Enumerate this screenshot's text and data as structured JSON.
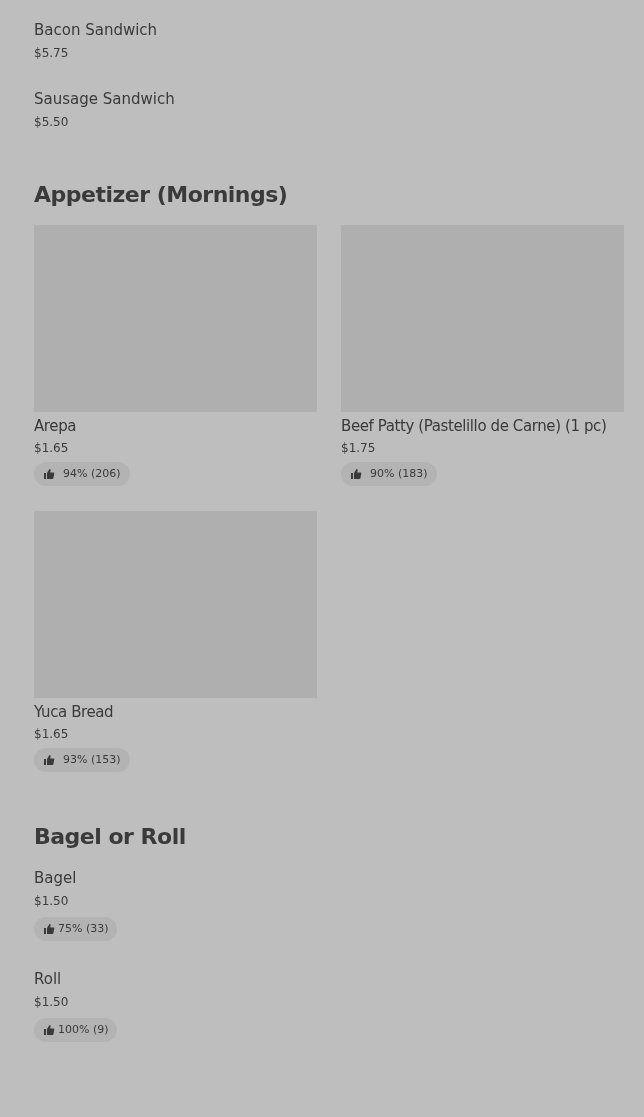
{
  "sections": [
    {
      "kind": "list",
      "items": [
        {
          "name": "Bacon Sandwich",
          "price": "$5.75"
        },
        {
          "name": "Sausage Sandwich",
          "price": "$5.50"
        }
      ]
    },
    {
      "heading": "Appetizer (Mornings)",
      "kind": "grid",
      "items": [
        {
          "name": "Arepa",
          "price": "$1.65",
          "rating": "94% (206)"
        },
        {
          "name": "Beef Patty (Pastelillo de Carne) (1 pc)",
          "price": "$1.75",
          "rating": "90% (183)"
        },
        {
          "name": "Yuca Bread",
          "price": "$1.65",
          "rating": "93% (153)"
        }
      ]
    },
    {
      "heading": "Bagel or Roll",
      "kind": "list",
      "items": [
        {
          "name": "Bagel",
          "price": "$1.50",
          "rating": "75% (33)"
        },
        {
          "name": "Roll",
          "price": "$1.50",
          "rating": "100% (9)"
        }
      ]
    }
  ]
}
